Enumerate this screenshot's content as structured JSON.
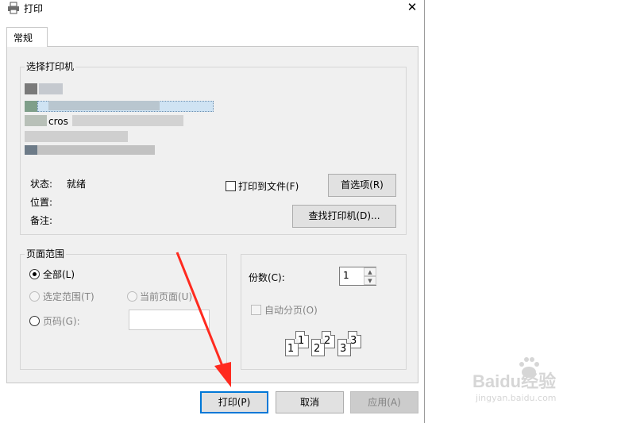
{
  "window": {
    "title": "打印",
    "close_glyph": "✕"
  },
  "tabs": [
    {
      "label": "常规"
    }
  ],
  "select_printer": {
    "label": "选择打印机",
    "visible_printer_text": "cros",
    "status_label": "状态:",
    "status_value": "就绪",
    "location_label": "位置:",
    "comment_label": "备注:",
    "print_to_file_label": "打印到文件(F)",
    "print_to_file_checked": false,
    "preferences_button": "首选项(R)",
    "find_printer_button": "查找打印机(D)..."
  },
  "page_range": {
    "label": "页面范围",
    "all_label": "全部(L)",
    "selection_label": "选定范围(T)",
    "current_page_label": "当前页面(U)",
    "pages_label": "页码(G):",
    "pages_value": ""
  },
  "copies": {
    "label": "份数(C):",
    "value": "1",
    "collate_label": "自动分页(O)",
    "collate_checked": false,
    "collate_pages": [
      [
        "1",
        "1"
      ],
      [
        "2",
        "2"
      ],
      [
        "3",
        "3"
      ]
    ]
  },
  "footer": {
    "print_button": "打印(P)",
    "cancel_button": "取消",
    "apply_button": "应用(A)"
  },
  "watermark": {
    "brand": "Baidu经验",
    "url": "jingyan.baidu.com"
  },
  "colors": {
    "annotation_arrow": "#ff2a1f",
    "dialog_bg": "#f0f0f0",
    "default_button_border": "#0078d7"
  }
}
